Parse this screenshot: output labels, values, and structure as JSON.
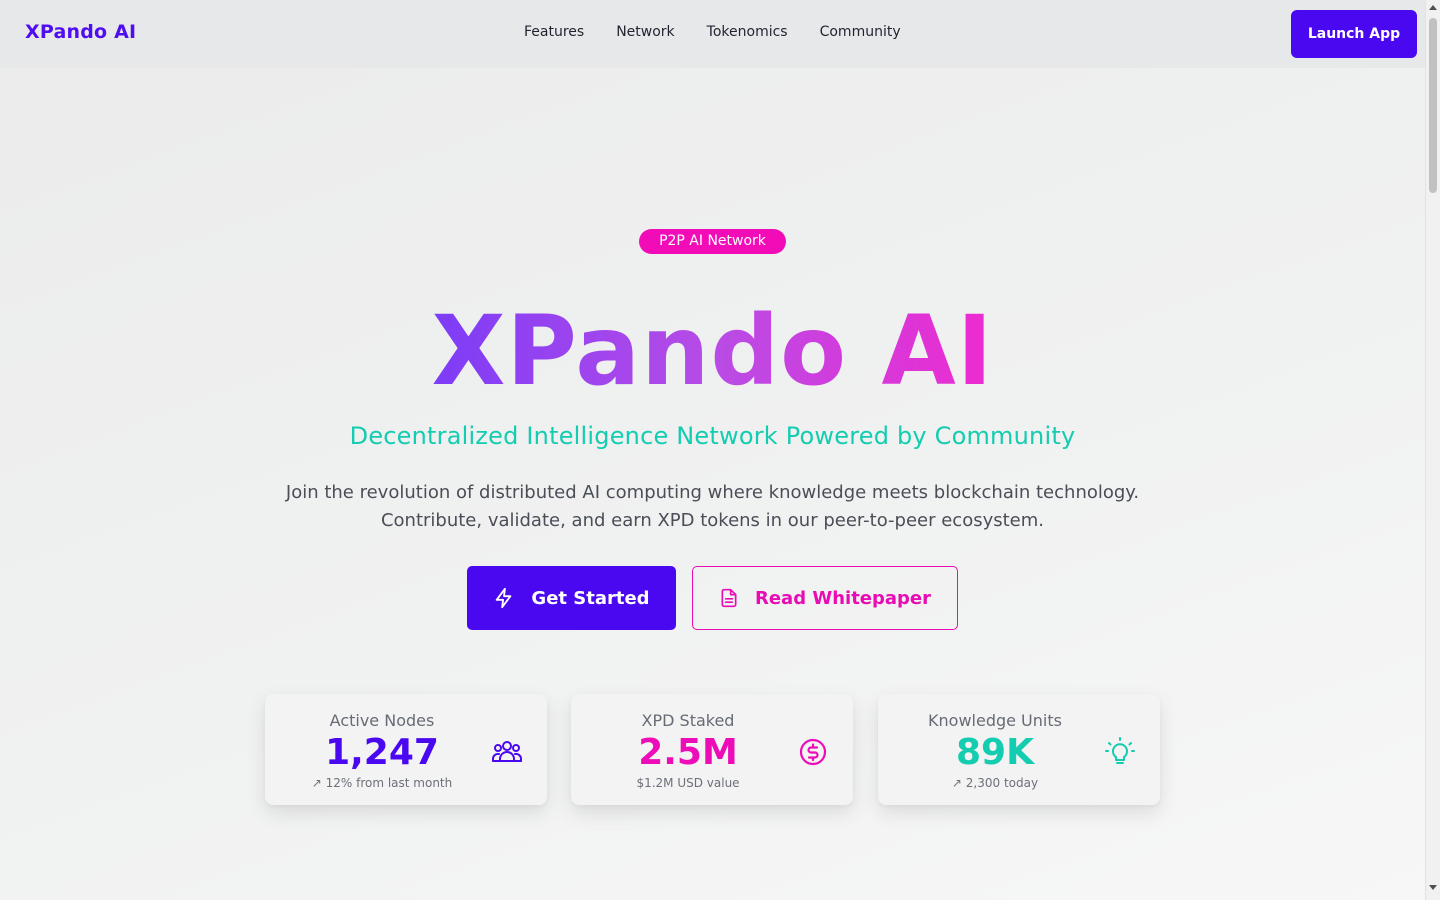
{
  "brand": "XPando AI",
  "nav": {
    "links": [
      "Features",
      "Network",
      "Tokenomics",
      "Community"
    ],
    "launch_label": "Launch App"
  },
  "hero": {
    "badge": "P2P AI Network",
    "title": "XPando AI",
    "subtitle": "Decentralized Intelligence Network Powered by Community",
    "description_line1": "Join the revolution of distributed AI computing where knowledge meets blockchain technology.",
    "description_line2": "Contribute, validate, and earn XPD tokens in our peer-to-peer ecosystem.",
    "primary_cta": "Get Started",
    "secondary_cta": "Read Whitepaper"
  },
  "stats": [
    {
      "label": "Active Nodes",
      "value": "1,247",
      "sub": "↗ 12% from last month",
      "icon": "users-icon",
      "color": "#4a08f0"
    },
    {
      "label": "XPD Staked",
      "value": "2.5M",
      "sub": "$1.2M USD value",
      "icon": "dollar-icon",
      "color": "#ec0cb8"
    },
    {
      "label": "Knowledge Units",
      "value": "89K",
      "sub": "↗ 2,300 today",
      "icon": "lightbulb-icon",
      "color": "#14cdb0"
    }
  ],
  "colors": {
    "brand_primary": "#4a08f0",
    "accent_pink": "#ec0cb8",
    "accent_teal": "#14cdb0"
  }
}
